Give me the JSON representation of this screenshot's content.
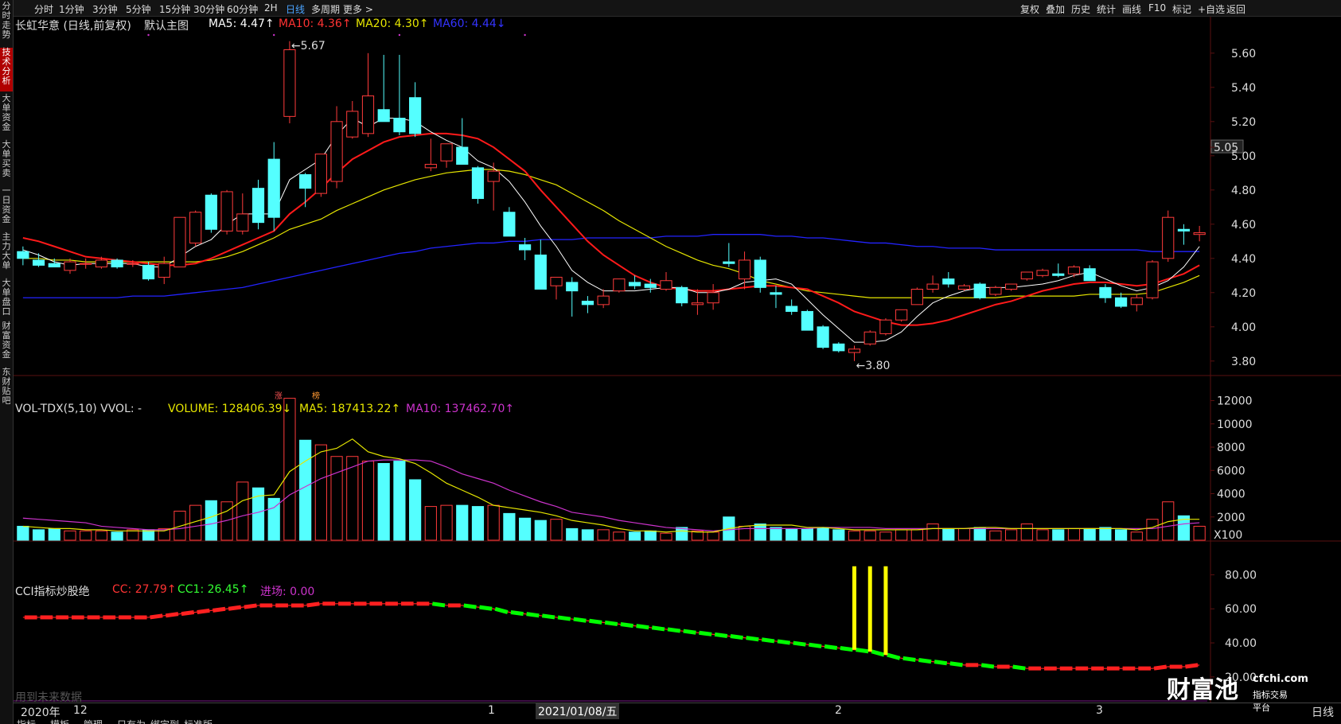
{
  "left_tabs": [
    "分时走势",
    "技术分析",
    "大单资金",
    "大单买卖",
    "一日资金",
    "主力大单",
    "大单盘口",
    "财富资金",
    "东财贴吧"
  ],
  "periods": [
    "分时",
    "1分钟",
    "3分钟",
    "5分钟",
    "15分钟",
    "30分钟",
    "60分钟",
    "2H",
    "日线",
    "多周期",
    "更多 >"
  ],
  "active_period": "日线",
  "toolbar": [
    "复权",
    "叠加",
    "历史",
    "统计",
    "画线",
    "F10",
    "标记",
    "+自选",
    "返回"
  ],
  "main_legend": {
    "stock": "长虹华意 (日线,前复权)",
    "indicator": "默认主图",
    "ma5": "MA5: 4.47↑",
    "ma10": "MA10: 4.36↑",
    "ma20": "MA20: 4.30↑",
    "ma60": "MA60: 4.44↓"
  },
  "price_axis": [
    "5.60",
    "5.40",
    "5.20",
    "5.05",
    "5.00",
    "4.80",
    "4.60",
    "4.40",
    "4.20",
    "4.00",
    "3.80"
  ],
  "price_high_label": "5.67",
  "price_low_label": "3.80",
  "vol_legend": {
    "name": "VOL-TDX(5,10) VVOL: -",
    "volume": "VOLUME: 128406.39↓",
    "ma5": "MA5: 187413.22↑",
    "ma10": "MA10: 137462.70↑",
    "badge1": "涨",
    "badge2": "榜"
  },
  "vol_axis": [
    "12000",
    "10000",
    "8000",
    "6000",
    "4000",
    "2000",
    "X100"
  ],
  "cci_legend": {
    "name": "CCI指标炒股绝",
    "cc": "CC: 27.79↑",
    "cc1": "CC1: 26.45↑",
    "entry": "进场: 0.00"
  },
  "cci_axis": [
    "80.00",
    "60.00",
    "40.00",
    "20.00"
  ],
  "watermark_note": "用到未来数据",
  "date_axis": {
    "year": "2020年",
    "m12": "12",
    "m1": "1",
    "cursor": "2021/01/08/五",
    "m2": "2",
    "m3": "3",
    "period": "日线"
  },
  "logo": {
    "main": "财富池",
    "domain": "cfchi.com",
    "sub": "指标交易平台"
  },
  "bottom_tabs": [
    "指标",
    "模板",
    "管理",
    "只有为",
    "绑定到",
    "标准版"
  ],
  "colors": {
    "up": "#ff3b3b",
    "down": "#54ffff",
    "ma5": "#ffffff",
    "ma10": "#ff1a1a",
    "ma20": "#e6e600",
    "ma60": "#2323ff",
    "vol_ma10": "#cc33cc",
    "cci_line": "#00ff00",
    "highlight": "#ffff00"
  },
  "chart_data": {
    "type": "candlestick",
    "candles": [
      {
        "o": 4.44,
        "h": 4.47,
        "l": 4.36,
        "c": 4.4
      },
      {
        "o": 4.39,
        "h": 4.43,
        "l": 4.35,
        "c": 4.36
      },
      {
        "o": 4.37,
        "h": 4.4,
        "l": 4.35,
        "c": 4.35
      },
      {
        "o": 4.33,
        "h": 4.4,
        "l": 4.31,
        "c": 4.38
      },
      {
        "o": 4.37,
        "h": 4.4,
        "l": 4.34,
        "c": 4.37
      },
      {
        "o": 4.35,
        "h": 4.41,
        "l": 4.34,
        "c": 4.39
      },
      {
        "o": 4.39,
        "h": 4.4,
        "l": 4.34,
        "c": 4.35
      },
      {
        "o": 4.37,
        "h": 4.39,
        "l": 4.35,
        "c": 4.37
      },
      {
        "o": 4.36,
        "h": 4.38,
        "l": 4.27,
        "c": 4.28
      },
      {
        "o": 4.29,
        "h": 4.41,
        "l": 4.25,
        "c": 4.37
      },
      {
        "o": 4.35,
        "h": 4.55,
        "l": 4.35,
        "c": 4.64
      },
      {
        "o": 4.49,
        "h": 4.68,
        "l": 4.47,
        "c": 4.67
      },
      {
        "o": 4.77,
        "h": 4.78,
        "l": 4.55,
        "c": 4.57
      },
      {
        "o": 4.56,
        "h": 4.8,
        "l": 4.54,
        "c": 4.79
      },
      {
        "o": 4.56,
        "h": 4.78,
        "l": 4.54,
        "c": 4.66
      },
      {
        "o": 4.81,
        "h": 4.86,
        "l": 4.57,
        "c": 4.61
      },
      {
        "o": 4.98,
        "h": 5.08,
        "l": 4.56,
        "c": 4.64
      },
      {
        "o": 5.23,
        "h": 5.67,
        "l": 5.19,
        "c": 5.62
      },
      {
        "o": 4.89,
        "h": 4.9,
        "l": 4.7,
        "c": 4.81
      },
      {
        "o": 4.78,
        "h": 4.99,
        "l": 4.76,
        "c": 5.01
      },
      {
        "o": 4.85,
        "h": 5.29,
        "l": 4.81,
        "c": 5.2
      },
      {
        "o": 5.11,
        "h": 5.32,
        "l": 5.1,
        "c": 5.26
      },
      {
        "o": 5.13,
        "h": 5.6,
        "l": 5.11,
        "c": 5.35
      },
      {
        "o": 5.27,
        "h": 5.59,
        "l": 5.23,
        "c": 5.2
      },
      {
        "o": 5.22,
        "h": 5.59,
        "l": 5.12,
        "c": 5.14
      },
      {
        "o": 5.34,
        "h": 5.43,
        "l": 5.11,
        "c": 5.13
      },
      {
        "o": 4.93,
        "h": 5.1,
        "l": 4.91,
        "c": 4.95
      },
      {
        "o": 4.97,
        "h": 5.02,
        "l": 4.93,
        "c": 5.07
      },
      {
        "o": 5.05,
        "h": 5.22,
        "l": 5.02,
        "c": 4.95
      },
      {
        "o": 4.93,
        "h": 4.94,
        "l": 4.72,
        "c": 4.75
      },
      {
        "o": 4.85,
        "h": 4.96,
        "l": 4.68,
        "c": 4.91
      },
      {
        "o": 4.67,
        "h": 4.7,
        "l": 4.53,
        "c": 4.53
      },
      {
        "o": 4.48,
        "h": 4.52,
        "l": 4.39,
        "c": 4.45
      },
      {
        "o": 4.42,
        "h": 4.51,
        "l": 4.22,
        "c": 4.22
      },
      {
        "o": 4.24,
        "h": 4.28,
        "l": 4.16,
        "c": 4.29
      },
      {
        "o": 4.26,
        "h": 4.29,
        "l": 4.06,
        "c": 4.21
      },
      {
        "o": 4.15,
        "h": 4.18,
        "l": 4.08,
        "c": 4.13
      },
      {
        "o": 4.13,
        "h": 4.22,
        "l": 4.11,
        "c": 4.18
      },
      {
        "o": 4.21,
        "h": 4.28,
        "l": 4.2,
        "c": 4.28
      },
      {
        "o": 4.26,
        "h": 4.3,
        "l": 4.22,
        "c": 4.24
      },
      {
        "o": 4.25,
        "h": 4.28,
        "l": 4.2,
        "c": 4.23
      },
      {
        "o": 4.22,
        "h": 4.32,
        "l": 4.21,
        "c": 4.27
      },
      {
        "o": 4.23,
        "h": 4.24,
        "l": 4.12,
        "c": 4.14
      },
      {
        "o": 4.13,
        "h": 4.22,
        "l": 4.07,
        "c": 4.14
      },
      {
        "o": 4.14,
        "h": 4.25,
        "l": 4.1,
        "c": 4.2
      },
      {
        "o": 4.38,
        "h": 4.49,
        "l": 4.35,
        "c": 4.37
      },
      {
        "o": 4.28,
        "h": 4.44,
        "l": 4.22,
        "c": 4.39
      },
      {
        "o": 4.39,
        "h": 4.41,
        "l": 4.2,
        "c": 4.23
      },
      {
        "o": 4.2,
        "h": 4.24,
        "l": 4.11,
        "c": 4.19
      },
      {
        "o": 4.12,
        "h": 4.16,
        "l": 4.07,
        "c": 4.09
      },
      {
        "o": 4.09,
        "h": 4.1,
        "l": 3.98,
        "c": 3.98
      },
      {
        "o": 4.0,
        "h": 4.01,
        "l": 3.87,
        "c": 3.88
      },
      {
        "o": 3.9,
        "h": 3.91,
        "l": 3.85,
        "c": 3.86
      },
      {
        "o": 3.85,
        "h": 3.89,
        "l": 3.8,
        "c": 3.87
      },
      {
        "o": 3.9,
        "h": 3.98,
        "l": 3.89,
        "c": 3.97
      },
      {
        "o": 3.96,
        "h": 4.05,
        "l": 3.95,
        "c": 4.04
      },
      {
        "o": 4.04,
        "h": 4.1,
        "l": 4.03,
        "c": 4.1
      },
      {
        "o": 4.13,
        "h": 4.23,
        "l": 4.13,
        "c": 4.22
      },
      {
        "o": 4.22,
        "h": 4.3,
        "l": 4.2,
        "c": 4.25
      },
      {
        "o": 4.28,
        "h": 4.32,
        "l": 4.23,
        "c": 4.25
      },
      {
        "o": 4.22,
        "h": 4.25,
        "l": 4.21,
        "c": 4.24
      },
      {
        "o": 4.25,
        "h": 4.26,
        "l": 4.16,
        "c": 4.17
      },
      {
        "o": 4.19,
        "h": 4.24,
        "l": 4.18,
        "c": 4.23
      },
      {
        "o": 4.22,
        "h": 4.25,
        "l": 4.21,
        "c": 4.25
      },
      {
        "o": 4.28,
        "h": 4.32,
        "l": 4.27,
        "c": 4.32
      },
      {
        "o": 4.3,
        "h": 4.34,
        "l": 4.29,
        "c": 4.33
      },
      {
        "o": 4.31,
        "h": 4.37,
        "l": 4.29,
        "c": 4.3
      },
      {
        "o": 4.31,
        "h": 4.36,
        "l": 4.29,
        "c": 4.35
      },
      {
        "o": 4.34,
        "h": 4.36,
        "l": 4.27,
        "c": 4.27
      },
      {
        "o": 4.23,
        "h": 4.25,
        "l": 4.14,
        "c": 4.17
      },
      {
        "o": 4.17,
        "h": 4.2,
        "l": 4.11,
        "c": 4.12
      },
      {
        "o": 4.13,
        "h": 4.19,
        "l": 4.09,
        "c": 4.17
      },
      {
        "o": 4.17,
        "h": 4.39,
        "l": 4.16,
        "c": 4.38
      },
      {
        "o": 4.4,
        "h": 4.68,
        "l": 4.38,
        "c": 4.64
      },
      {
        "o": 4.57,
        "h": 4.6,
        "l": 4.48,
        "c": 4.56
      },
      {
        "o": 4.54,
        "h": 4.59,
        "l": 4.5,
        "c": 4.55
      }
    ],
    "volume": [
      1.2,
      0.9,
      1.0,
      0.8,
      0.8,
      0.8,
      0.7,
      0.9,
      0.9,
      1.0,
      2.5,
      3.0,
      3.4,
      3.3,
      5.0,
      4.5,
      3.6,
      12.2,
      8.6,
      8.2,
      7.2,
      7.2,
      6.8,
      6.6,
      6.8,
      5.2,
      2.9,
      3.0,
      3.0,
      2.9,
      3.0,
      2.3,
      1.9,
      1.7,
      1.8,
      1.0,
      0.9,
      0.9,
      0.7,
      0.7,
      0.8,
      0.6,
      1.1,
      0.8,
      0.7,
      2.0,
      1.2,
      1.4,
      1.1,
      1.0,
      1.0,
      1.1,
      0.9,
      0.8,
      0.8,
      0.7,
      0.9,
      0.9,
      1.4,
      1.0,
      1.0,
      1.1,
      0.8,
      0.9,
      1.4,
      0.9,
      0.9,
      1.0,
      1.0,
      1.1,
      0.9,
      0.7,
      1.8,
      3.3,
      2.1,
      1.2
    ],
    "ma5": [
      4.45,
      4.42,
      4.38,
      4.36,
      4.37,
      4.37,
      4.37,
      4.37,
      4.35,
      4.35,
      4.41,
      4.47,
      4.51,
      4.6,
      4.66,
      4.66,
      4.66,
      4.86,
      4.92,
      4.98,
      5.12,
      5.22,
      5.17,
      5.22,
      5.22,
      5.2,
      5.14,
      5.09,
      5.05,
      4.97,
      4.93,
      4.85,
      4.73,
      4.59,
      4.47,
      4.33,
      4.26,
      4.21,
      4.21,
      4.21,
      4.22,
      4.23,
      4.23,
      4.2,
      4.2,
      4.22,
      4.26,
      4.27,
      4.28,
      4.25,
      4.16,
      4.07,
      3.99,
      3.91,
      3.91,
      3.92,
      3.97,
      4.06,
      4.14,
      4.18,
      4.21,
      4.23,
      4.23,
      4.23,
      4.24,
      4.25,
      4.27,
      4.3,
      4.32,
      4.28,
      4.24,
      4.21,
      4.23,
      4.27,
      4.35,
      4.47
    ],
    "ma10": [
      4.52,
      4.5,
      4.47,
      4.44,
      4.41,
      4.4,
      4.39,
      4.38,
      4.37,
      4.36,
      4.36,
      4.37,
      4.4,
      4.44,
      4.48,
      4.52,
      4.56,
      4.66,
      4.73,
      4.81,
      4.9,
      4.98,
      5.03,
      5.08,
      5.11,
      5.12,
      5.13,
      5.13,
      5.12,
      5.1,
      5.05,
      4.98,
      4.91,
      4.8,
      4.7,
      4.6,
      4.5,
      4.42,
      4.36,
      4.3,
      4.26,
      4.23,
      4.22,
      4.21,
      4.21,
      4.22,
      4.23,
      4.24,
      4.24,
      4.23,
      4.22,
      4.18,
      4.14,
      4.09,
      4.06,
      4.03,
      4.01,
      4.01,
      4.02,
      4.04,
      4.07,
      4.1,
      4.13,
      4.15,
      4.18,
      4.21,
      4.23,
      4.25,
      4.26,
      4.26,
      4.25,
      4.24,
      4.25,
      4.28,
      4.31,
      4.36
    ],
    "ma20": [
      4.4,
      4.4,
      4.39,
      4.39,
      4.38,
      4.38,
      4.38,
      4.38,
      4.38,
      4.38,
      4.38,
      4.38,
      4.39,
      4.41,
      4.44,
      4.48,
      4.52,
      4.57,
      4.6,
      4.63,
      4.68,
      4.72,
      4.76,
      4.8,
      4.83,
      4.86,
      4.88,
      4.9,
      4.91,
      4.92,
      4.92,
      4.91,
      4.89,
      4.86,
      4.83,
      4.78,
      4.73,
      4.68,
      4.62,
      4.57,
      4.52,
      4.47,
      4.43,
      4.39,
      4.36,
      4.34,
      4.31,
      4.27,
      4.25,
      4.23,
      4.21,
      4.2,
      4.19,
      4.18,
      4.17,
      4.17,
      4.17,
      4.17,
      4.17,
      4.17,
      4.17,
      4.17,
      4.17,
      4.18,
      4.18,
      4.18,
      4.18,
      4.18,
      4.19,
      4.19,
      4.19,
      4.19,
      4.2,
      4.23,
      4.26,
      4.3
    ],
    "ma60": [
      4.17,
      4.17,
      4.17,
      4.17,
      4.17,
      4.17,
      4.17,
      4.18,
      4.18,
      4.18,
      4.19,
      4.2,
      4.21,
      4.22,
      4.23,
      4.25,
      4.27,
      4.29,
      4.31,
      4.33,
      4.35,
      4.37,
      4.39,
      4.41,
      4.43,
      4.44,
      4.46,
      4.47,
      4.48,
      4.49,
      4.49,
      4.5,
      4.5,
      4.51,
      4.51,
      4.51,
      4.52,
      4.52,
      4.52,
      4.52,
      4.52,
      4.53,
      4.53,
      4.53,
      4.54,
      4.54,
      4.54,
      4.54,
      4.53,
      4.53,
      4.52,
      4.52,
      4.51,
      4.5,
      4.49,
      4.49,
      4.48,
      4.47,
      4.47,
      4.46,
      4.46,
      4.46,
      4.45,
      4.45,
      4.45,
      4.45,
      4.45,
      4.45,
      4.45,
      4.45,
      4.45,
      4.45,
      4.44,
      4.44,
      4.44,
      4.44
    ],
    "vol_ma5": [
      1.2,
      1.1,
      1.0,
      1.0,
      0.9,
      0.9,
      0.8,
      0.8,
      0.8,
      0.8,
      1.2,
      1.6,
      2.0,
      2.5,
      3.4,
      3.8,
      3.9,
      5.9,
      6.8,
      7.6,
      7.9,
      8.7,
      7.6,
      7.2,
      7.0,
      6.6,
      5.8,
      4.9,
      4.3,
      3.7,
      3.0,
      2.8,
      2.6,
      2.4,
      2.1,
      1.7,
      1.5,
      1.3,
      1.0,
      0.8,
      0.8,
      0.7,
      0.8,
      0.7,
      0.7,
      1.0,
      1.2,
      1.3,
      1.3,
      1.3,
      1.1,
      1.1,
      1.0,
      0.9,
      0.9,
      0.9,
      0.9,
      0.9,
      1.0,
      1.0,
      1.0,
      1.1,
      1.1,
      1.0,
      1.0,
      1.0,
      1.0,
      1.0,
      1.0,
      1.0,
      1.0,
      0.9,
      1.1,
      1.6,
      1.8,
      1.8
    ],
    "vol_ma10": [
      1.9,
      1.8,
      1.7,
      1.6,
      1.5,
      1.2,
      1.1,
      1.0,
      0.9,
      0.9,
      1.0,
      1.2,
      1.4,
      1.7,
      2.1,
      2.4,
      2.8,
      3.9,
      4.6,
      5.3,
      5.8,
      6.3,
      6.8,
      6.9,
      6.9,
      6.9,
      6.8,
      6.3,
      5.7,
      5.3,
      4.9,
      4.3,
      3.8,
      3.3,
      2.9,
      2.4,
      2.2,
      2.0,
      1.7,
      1.5,
      1.3,
      1.1,
      1.0,
      0.9,
      0.8,
      0.9,
      1.0,
      1.0,
      1.0,
      1.0,
      1.0,
      1.1,
      1.1,
      1.1,
      1.1,
      1.0,
      1.0,
      1.0,
      1.0,
      1.0,
      1.0,
      1.0,
      1.0,
      1.0,
      1.0,
      1.0,
      1.0,
      1.0,
      1.0,
      1.0,
      1.0,
      1.0,
      1.0,
      1.2,
      1.4,
      1.5
    ],
    "cci": [
      55,
      55,
      55,
      55,
      55,
      55,
      55,
      55,
      55,
      56,
      57,
      58,
      59,
      60,
      61,
      62,
      62,
      62,
      62,
      63,
      63,
      63,
      63,
      63,
      63,
      63,
      63,
      62,
      62,
      61,
      60,
      58,
      57,
      56,
      55,
      54,
      53,
      52,
      51,
      50,
      49,
      48,
      47,
      46,
      45,
      44,
      43,
      42,
      41,
      40,
      39,
      38,
      37,
      36,
      35,
      33,
      31,
      30,
      29,
      28,
      27,
      27,
      26,
      26,
      25,
      25,
      25,
      25,
      25,
      25,
      25,
      25,
      25,
      26,
      26,
      27
    ],
    "signals": [
      53,
      54,
      55
    ],
    "price_range": [
      3.72,
      5.72
    ],
    "vol_range": [
      0,
      13.2
    ],
    "cci_range": [
      5,
      90
    ]
  }
}
